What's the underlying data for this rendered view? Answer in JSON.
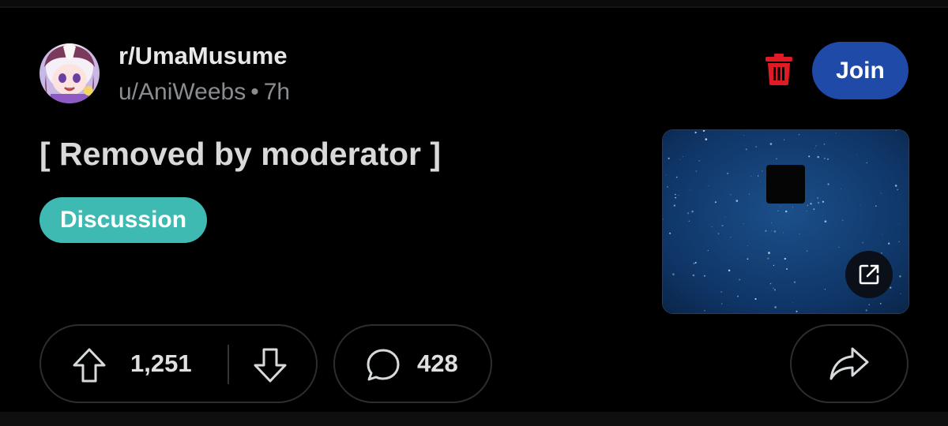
{
  "post": {
    "subreddit": "r/UmaMusume",
    "author": "u/AniWeebs",
    "separator": "•",
    "age": "7h",
    "title": "[ Removed by moderator ]",
    "flair": "Discussion"
  },
  "actions": {
    "join_label": "Join",
    "trash_icon": "trash-icon",
    "trash_color": "#e01b24"
  },
  "thumbnail": {
    "external_link_icon": "external-link-icon"
  },
  "stats": {
    "votes": "1,251",
    "comments": "428"
  },
  "colors": {
    "join_bg": "#1f4aa8",
    "flair_bg": "#3fbab2",
    "background": "#000000"
  }
}
